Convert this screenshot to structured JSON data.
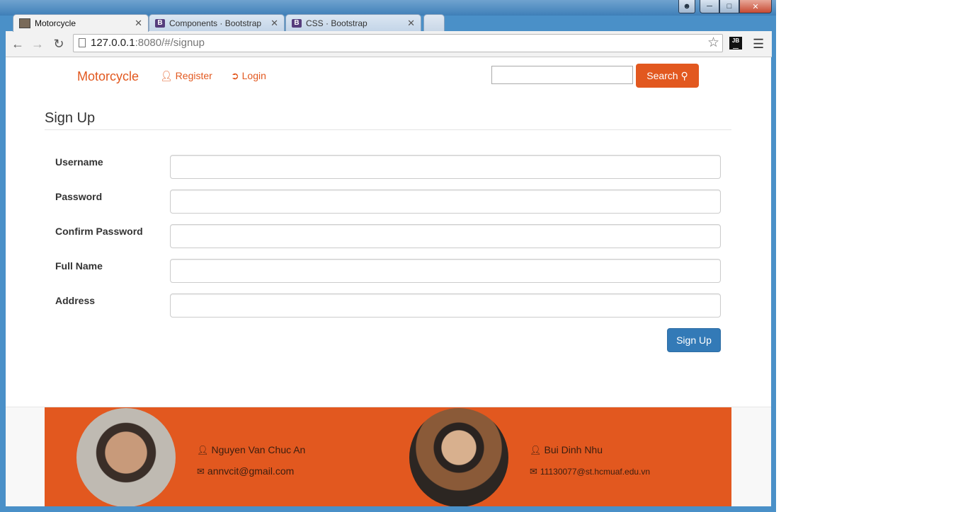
{
  "browser": {
    "tabs": [
      {
        "label": "Motorcycle",
        "icon": "motorcycle-favicon-icon",
        "active": true
      },
      {
        "label": "Components · Bootstrap",
        "icon": "bootstrap-favicon-icon",
        "active": false
      },
      {
        "label": "CSS · Bootstrap",
        "icon": "bootstrap-favicon-icon",
        "active": false
      }
    ],
    "url_host": "127.0.0.1",
    "url_rest": ":8080/#/signup",
    "jb_label": "JB"
  },
  "navbar": {
    "brand": "Motorcycle",
    "register": "Register",
    "login": "Login",
    "search_button": "Search",
    "search_value": ""
  },
  "signup": {
    "title": "Sign Up",
    "fields": [
      {
        "label": "Username",
        "value": ""
      },
      {
        "label": "Password",
        "value": ""
      },
      {
        "label": "Confirm Password",
        "value": ""
      },
      {
        "label": "Full Name",
        "value": ""
      },
      {
        "label": "Address",
        "value": ""
      }
    ],
    "submit_label": "Sign Up"
  },
  "footer": {
    "authors": [
      {
        "name": "Nguyen Van Chuc An",
        "email": "annvcit@gmail.com"
      },
      {
        "name": "Bui Dinh Nhu",
        "email": "11130077@st.hcmuaf.edu.vn"
      }
    ]
  },
  "colors": {
    "accent": "#e2581f",
    "primary_button": "#337ab7"
  }
}
